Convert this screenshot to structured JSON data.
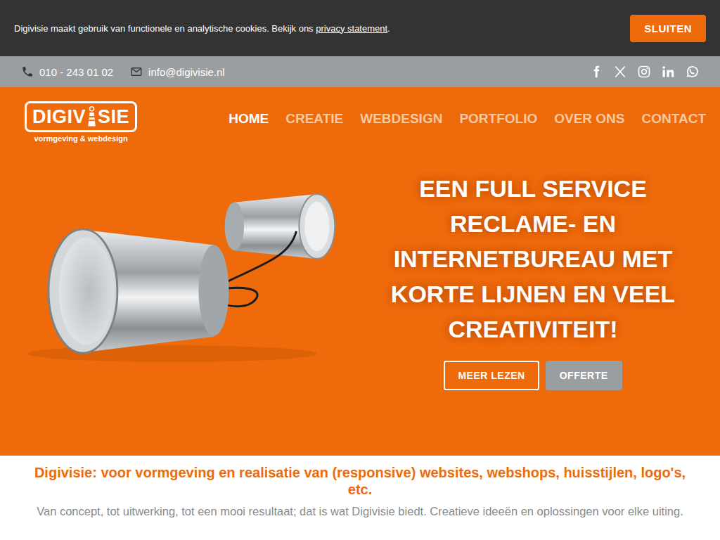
{
  "cookie_bar": {
    "text": "Digivisie maakt gebruik van functionele en analytische cookies. Bekijk ons ",
    "link": "privacy statement",
    "after": ".",
    "button": "SLUITEN"
  },
  "contact_bar": {
    "phone": "010 - 243 01 02",
    "email": "info@digivisie.nl"
  },
  "logo": {
    "left": "DIGIV",
    "right": "SIE",
    "tagline": "vormgeving & webdesign"
  },
  "nav": [
    {
      "label": "HOME",
      "selected": true
    },
    {
      "label": "CREATIE",
      "selected": false
    },
    {
      "label": "WEBDESIGN",
      "selected": false
    },
    {
      "label": "PORTFOLIO",
      "selected": false
    },
    {
      "label": "OVER ONS",
      "selected": false
    },
    {
      "label": "CONTACT",
      "selected": false
    }
  ],
  "hero": {
    "headline_lines": [
      "EEN FULL SERVICE",
      "RECLAME- EN",
      "INTERNETBUREAU MET",
      "KORTE LIJNEN EN VEEL",
      "CREATIVITEIT!"
    ],
    "buttons": [
      {
        "label": "MEER LEZEN",
        "kind": "outline"
      },
      {
        "label": "OFFERTE",
        "kind": "grey"
      }
    ]
  },
  "intro": {
    "heading": "Digivisie: voor vormgeving en realisatie van (responsive) websites, webshops, huisstijlen, logo's, etc.",
    "text": "Van concept, tot uitwerking, tot een mooi resultaat; dat is wat Digivisie biedt. Creatieve ideeën en oplossingen voor elke uiting."
  }
}
